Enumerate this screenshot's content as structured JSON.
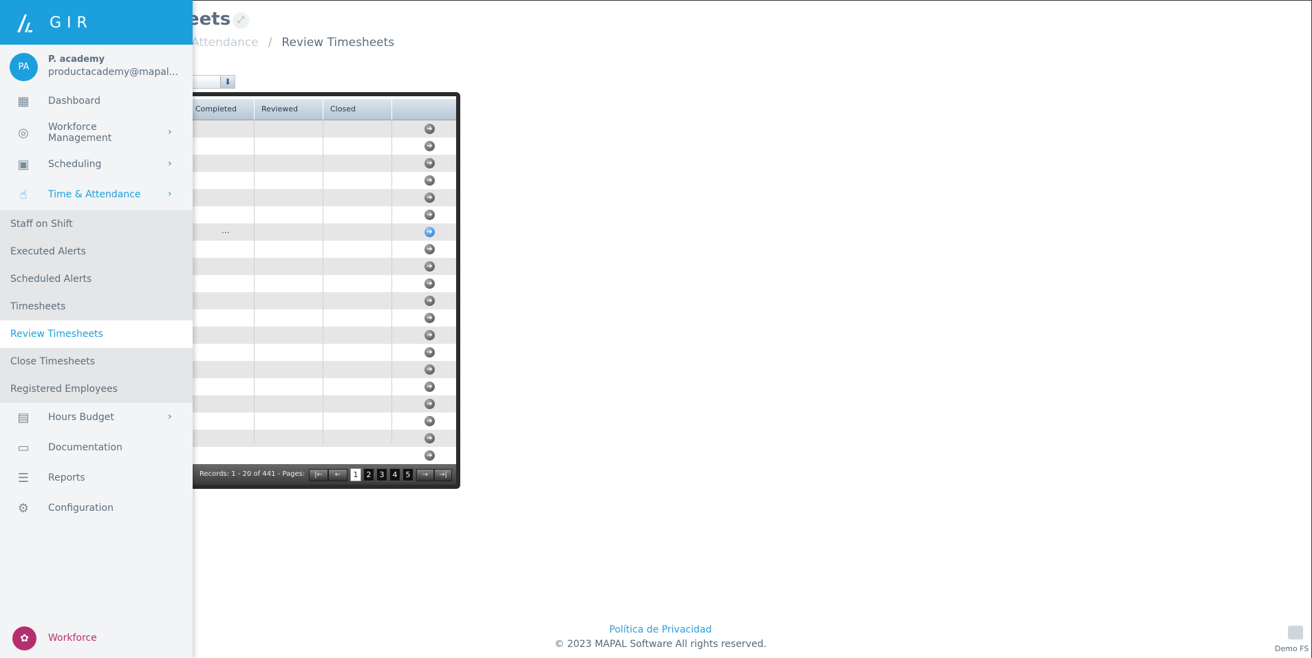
{
  "header": {
    "title": "eets",
    "expand_icon": "expand-icon"
  },
  "breadcrumb": {
    "item1": "Attendance",
    "separator": "/",
    "item2": "Review Timesheets"
  },
  "grid": {
    "columns": [
      "Completed",
      "Reviewed",
      "Closed"
    ],
    "row_count": 20,
    "ellipsis": "...",
    "active_row": 6,
    "pager": {
      "info": "Records: 1 - 20 of 441 - Pages:",
      "pages": [
        "1",
        "2",
        "3",
        "4",
        "5"
      ],
      "current": "1",
      "first": "|←",
      "prev": "←",
      "next": "→",
      "last": "→|"
    }
  },
  "footer": {
    "privacy": "Política de Privacidad",
    "copyright": "© 2023 MAPAL Software All rights reserved.",
    "demo": "Demo FS"
  },
  "sidebar": {
    "logo_text": "GIR",
    "user": {
      "initials": "PA",
      "name": "P. academy",
      "email": "productacademy@mapal..."
    },
    "items": [
      {
        "label": "Dashboard",
        "icon": "dashboard-icon",
        "glyph": "▦"
      },
      {
        "label": "Workforce Management",
        "icon": "user-circle-icon",
        "glyph": "◎"
      },
      {
        "label": "Scheduling",
        "icon": "calendar-clock-icon",
        "glyph": "▣"
      },
      {
        "label": "Time & Attendance",
        "icon": "hand-touch-icon",
        "glyph": "☝"
      }
    ],
    "submenu": [
      "Staff on Shift",
      "Executed Alerts",
      "Scheduled Alerts",
      "Timesheets",
      "Review Timesheets",
      "Close Timesheets",
      "Registered Employees"
    ],
    "items2": [
      {
        "label": "Hours Budget",
        "icon": "budget-icon",
        "glyph": "▤"
      },
      {
        "label": "Documentation",
        "icon": "archive-icon",
        "glyph": "▭"
      },
      {
        "label": "Reports",
        "icon": "reports-icon",
        "glyph": "☰"
      },
      {
        "label": "Configuration",
        "icon": "gear-icon",
        "glyph": "⚙"
      }
    ],
    "chevron": "›",
    "bottom": {
      "label": "Workforce",
      "icon": "workforce-logo-icon"
    }
  },
  "colors": {
    "brand": "#1ba0dd",
    "workforce": "#b52f6e"
  }
}
